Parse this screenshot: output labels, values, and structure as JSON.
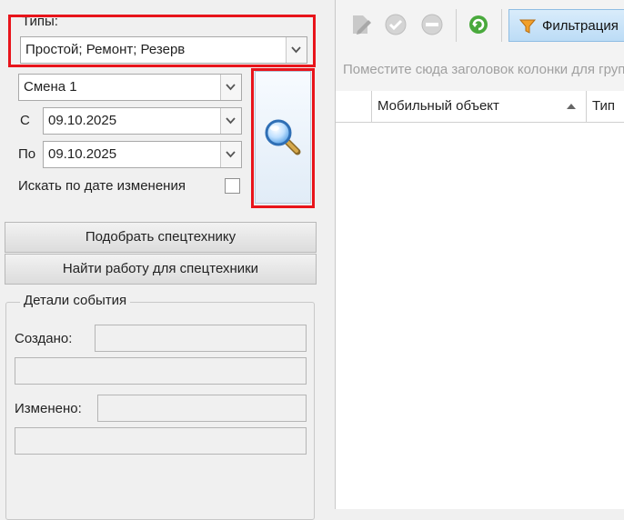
{
  "filters": {
    "types_label": "Типы:",
    "types_value": "Простой; Ремонт; Резерв",
    "shift_value": "Смена 1",
    "from_label": "С",
    "from_value": "09.10.2025",
    "to_label": "По",
    "to_value": "09.10.2025",
    "search_by_change_label": "Искать по дате изменения",
    "search_by_change_checked": false
  },
  "actions": {
    "pick_equipment": "Подобрать спецтехнику",
    "find_work": "Найти работу для спецтехники"
  },
  "event_details": {
    "title": "Детали события",
    "created_label": "Создано:",
    "created_value": "",
    "created_extra": "",
    "modified_label": "Изменено:",
    "modified_value": "",
    "modified_extra": ""
  },
  "toolbar": {
    "filter_label": "Фильтрация"
  },
  "grid": {
    "group_hint": "Поместите сюда заголовок колонки для группировки",
    "columns": [
      "Мобильный объект",
      "Тип"
    ]
  },
  "colors": {
    "highlight": "#e8141b",
    "accent": "#3b8fd6"
  }
}
